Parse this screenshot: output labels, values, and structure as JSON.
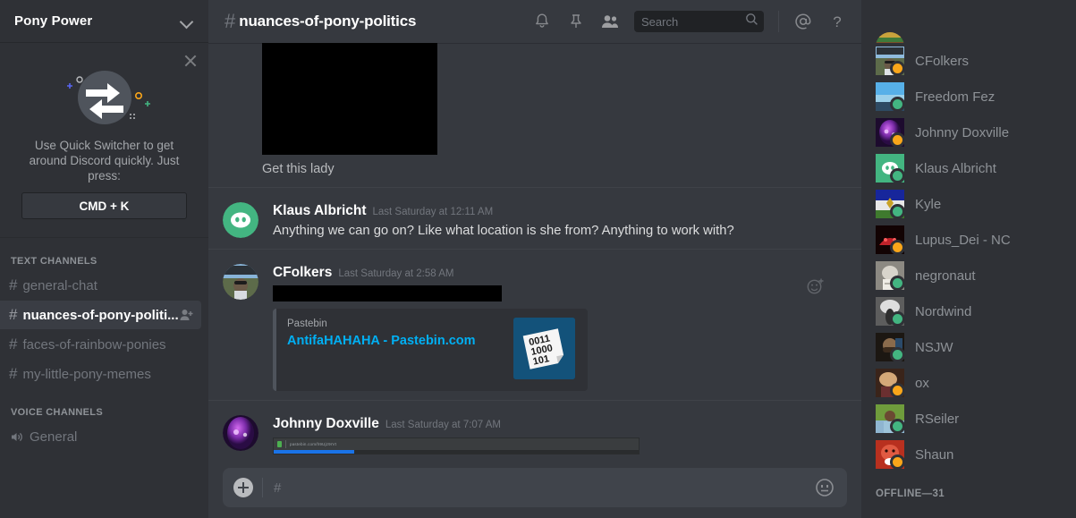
{
  "server": {
    "name": "Pony Power",
    "chevron_icon": "chevron-down-icon"
  },
  "tip": {
    "close_icon": "close-icon",
    "art_icon": "quick-switcher-arrows-icon",
    "text": "Use Quick Switcher to get around Discord quickly. Just press:",
    "shortcut": "CMD + K"
  },
  "sidebar": {
    "text_category": "TEXT CHANNELS",
    "voice_category": "VOICE CHANNELS",
    "hash": "#",
    "text_channels": [
      {
        "name": "general-chat",
        "active": false
      },
      {
        "name": "nuances-of-pony-politi...",
        "active": true,
        "invite_icon": "add-member-icon"
      },
      {
        "name": "faces-of-rainbow-ponies",
        "active": false
      },
      {
        "name": "my-little-pony-memes",
        "active": false
      }
    ],
    "voice_channels": [
      {
        "name": "General",
        "icon": "speaker-icon"
      }
    ]
  },
  "header": {
    "hash": "#",
    "channel": "nuances-of-pony-politics",
    "icons": [
      {
        "name": "bell-icon"
      },
      {
        "name": "pin-icon"
      },
      {
        "name": "members-icon"
      }
    ],
    "search": {
      "placeholder": "Search",
      "value": "",
      "icon": "search-icon"
    },
    "mentions_icon": "at-mention-icon",
    "help_icon": "help-question-icon"
  },
  "messages": [
    {
      "type": "image-attachment",
      "caption": "Get this lady",
      "image": "redacted-black-image"
    },
    {
      "type": "text",
      "author": "Klaus Albricht",
      "timestamp": "Last Saturday at 12:11 AM",
      "avatar": "discord-logo-green-avatar",
      "text": "Anything we can go on? Like what location is she from? Anything to work with?"
    },
    {
      "type": "embed",
      "author": "CFolkers",
      "timestamp": "Last Saturday at 2:58 AM",
      "avatar": "photo-person-car-avatar",
      "text_redacted": true,
      "react_icon": "add-reaction-icon",
      "embed": {
        "site": "Pastebin",
        "title": "AntifaHAHAHA - Pastebin.com",
        "thumb": "binary-paste-icon",
        "thumb_digits": [
          "0011",
          "1000",
          "101"
        ]
      }
    },
    {
      "type": "screenshot",
      "author": "Johnny Doxville",
      "timestamp": "Last Saturday at 7:07 AM",
      "avatar": "purple-orb-avatar",
      "screenshot_url": "pastebin.com/h9Ujz9rVt"
    }
  ],
  "composer": {
    "plus_icon": "add-attachment-icon",
    "placeholder": "#",
    "emoji_icon": "emoji-picker-icon"
  },
  "member_list": {
    "online": [
      {
        "name": "CFolkers",
        "status": "idle",
        "avatar_colors": [
          "#7a9fc4",
          "#3f4a32"
        ]
      },
      {
        "name": "Freedom Fez",
        "status": "online",
        "avatar_colors": [
          "#4aa3df",
          "#2e4a63"
        ]
      },
      {
        "name": "Johnny Doxville",
        "status": "idle",
        "avatar_colors": [
          "#b14fd8",
          "#4b1d6b"
        ]
      },
      {
        "name": "Klaus Albricht",
        "status": "online",
        "avatar_colors": [
          "#43b581",
          "#3aa876"
        ]
      },
      {
        "name": "Kyle",
        "status": "online",
        "avatar_colors": [
          "#1a2f8a",
          "#3f7a2e"
        ]
      },
      {
        "name": "Lupus_Dei - NC",
        "status": "idle",
        "avatar_colors": [
          "#c0222a",
          "#6a0b10"
        ]
      },
      {
        "name": "negronaut",
        "status": "online",
        "avatar_colors": [
          "#b9b4ab",
          "#6e6a62"
        ]
      },
      {
        "name": "Nordwind",
        "status": "online",
        "avatar_colors": [
          "#c9c9c9",
          "#3a3a3a"
        ]
      },
      {
        "name": "NSJW",
        "status": "online",
        "avatar_colors": [
          "#6d5a45",
          "#2a2018"
        ]
      },
      {
        "name": "ox",
        "status": "idle",
        "avatar_colors": [
          "#c99a6e",
          "#5a3626"
        ]
      },
      {
        "name": "RSeiler",
        "status": "online",
        "avatar_colors": [
          "#5b8f3a",
          "#8fb5d0"
        ]
      },
      {
        "name": "Shaun",
        "status": "idle",
        "avatar_colors": [
          "#d9412a",
          "#8a1c10"
        ]
      }
    ],
    "offline_header": "OFFLINE—31"
  },
  "colors": {
    "sidebar_bg": "#2f3136",
    "main_bg": "#36393f",
    "accent_link": "#00b0f4",
    "online": "#43b581",
    "idle": "#faa61a"
  }
}
